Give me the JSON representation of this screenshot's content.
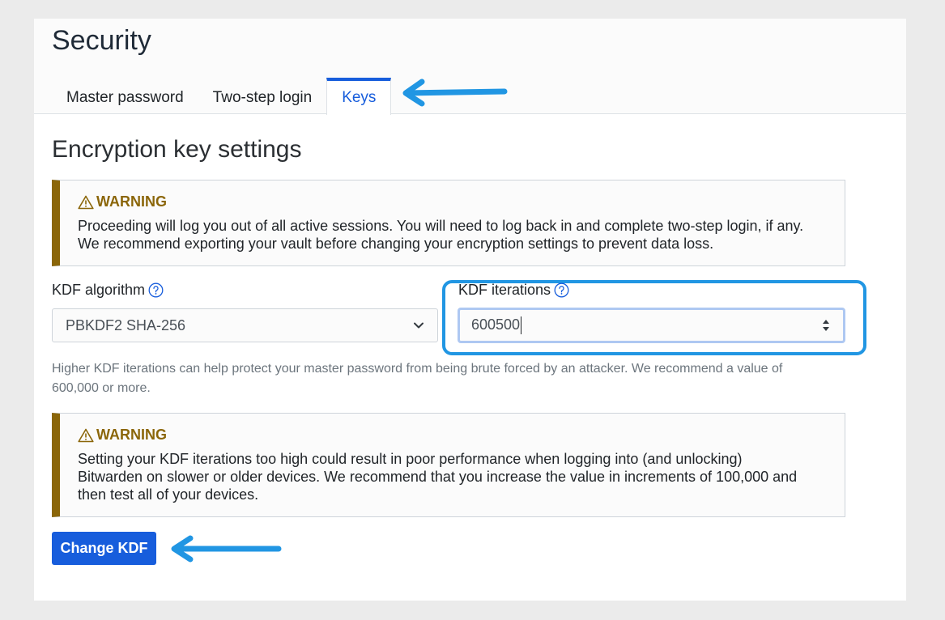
{
  "page": {
    "title": "Security"
  },
  "tabs": [
    {
      "label": "Master password",
      "active": false
    },
    {
      "label": "Two-step login",
      "active": false
    },
    {
      "label": "Keys",
      "active": true
    }
  ],
  "section": {
    "title": "Encryption key settings"
  },
  "warning1": {
    "title": "WARNING",
    "icon": "warning-triangle-icon",
    "lines": [
      "Proceeding will log you out of all active sessions. You will need to log back in and complete two-step login, if any.",
      "We recommend exporting your vault before changing your encryption settings to prevent data loss."
    ]
  },
  "kdf": {
    "algorithm_label": "KDF algorithm",
    "algorithm_value": "PBKDF2 SHA-256",
    "iterations_label": "KDF iterations",
    "iterations_value": "600500",
    "hint": "Higher KDF iterations can help protect your master password from being brute forced by an attacker. We recommend a value of 600,000 or more."
  },
  "warning2": {
    "title": "WARNING",
    "icon": "warning-triangle-icon",
    "lines": [
      "Setting your KDF iterations too high could result in poor performance when logging into (and unlocking)",
      "Bitwarden on slower or older devices. We recommend that you increase the value in increments of 100,000 and",
      "then test all of your devices."
    ]
  },
  "button": {
    "label": "Change KDF"
  },
  "colors": {
    "accent": "#175ddc",
    "warning": "#8b6609",
    "annotation": "#2196e3"
  }
}
